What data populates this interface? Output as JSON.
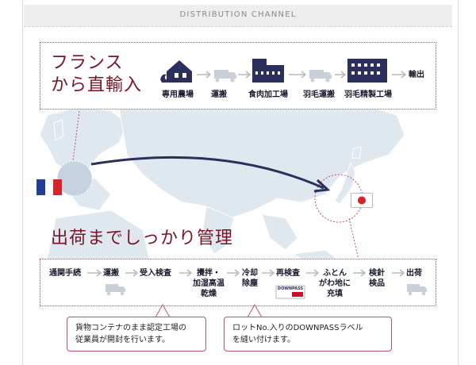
{
  "header": {
    "title": "DISTRIBUTION CHANNEL"
  },
  "top_section": {
    "title_line1": "フランス",
    "title_line2": "から直輸入",
    "steps": [
      {
        "label": "専用農場",
        "icon": "farm-duck-icon"
      },
      {
        "label": "運搬",
        "icon": "truck-icon"
      },
      {
        "label": "食肉加工場",
        "icon": "factory-icon"
      },
      {
        "label": "羽毛運搬",
        "icon": "truck-icon"
      },
      {
        "label": "羽毛精製工場",
        "icon": "factory-icon"
      },
      {
        "label": "輸出",
        "icon": ""
      }
    ]
  },
  "bottom_section": {
    "title": "出荷までしっかり管理",
    "steps": [
      {
        "label": "通関手続"
      },
      {
        "label": "運搬",
        "icon": "truck-icon"
      },
      {
        "label": "受入検査"
      },
      {
        "label_lines": [
          "攪拌・",
          "加湿高温",
          "乾燥"
        ]
      },
      {
        "label_lines": [
          "冷却",
          "除塵"
        ]
      },
      {
        "label": "再検査",
        "icon": "downpass-label-icon",
        "badge_text": "DOWNPASS"
      },
      {
        "label_lines": [
          "ふとん",
          "がわ地に",
          "充填"
        ]
      },
      {
        "label_lines": [
          "検針",
          "検品"
        ]
      },
      {
        "label": "出荷",
        "icon": "truck-icon"
      }
    ],
    "callouts": [
      {
        "lines": [
          "貨物コンテナのまま認定工場の",
          "従業員が開封を行います。"
        ]
      },
      {
        "lines": [
          "ロットNo.入りのDOWNPASSラベル",
          "を縫い付けます。"
        ]
      }
    ]
  },
  "colors": {
    "accent": "#7b1426",
    "navy": "#2a2f5c",
    "map": "#dde6ee",
    "arrow_gray": "#b8b8b8",
    "callout_border": "#b9556a"
  },
  "flags": {
    "origin": "france-flag-icon",
    "destination": "japan-flag-icon"
  }
}
